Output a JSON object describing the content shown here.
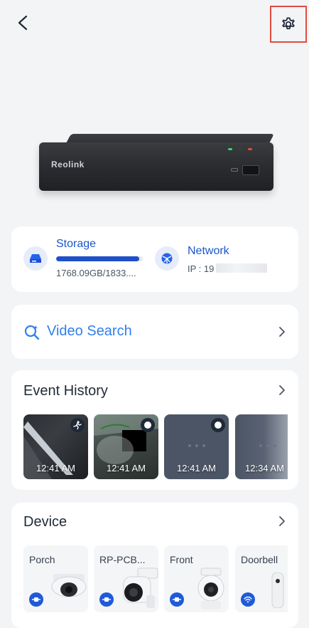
{
  "header": {
    "back_icon": "chevron-left-icon",
    "settings_icon": "gear-icon",
    "highlight_color": "#e04b3f"
  },
  "device_image": {
    "brand": "Reolink"
  },
  "storage": {
    "title": "Storage",
    "usage": "1768.09GB/1833....",
    "used_fraction": 0.96,
    "icon": "hard-drive-icon"
  },
  "network": {
    "title": "Network",
    "ip": "IP : 19",
    "icon": "network-globe-icon"
  },
  "video_search": {
    "label": "Video Search",
    "icon": "search-sparkle-icon"
  },
  "event_history": {
    "title": "Event History",
    "items": [
      {
        "time": "12:41 AM",
        "badge": "person-icon"
      },
      {
        "time": "12:41 AM",
        "badge": "circle-icon"
      },
      {
        "time": "12:41 AM",
        "badge": "circle-icon"
      },
      {
        "time": "12:34 AM",
        "badge": "circle-icon"
      }
    ]
  },
  "device": {
    "title": "Device",
    "items": [
      {
        "name": "Porch",
        "badge": "plug-icon"
      },
      {
        "name": "RP-PCB...",
        "badge": "plug-icon"
      },
      {
        "name": "Front",
        "badge": "plug-icon"
      },
      {
        "name": "Doorbell",
        "badge": "wifi-icon"
      }
    ]
  },
  "colors": {
    "accent": "#1a56c9",
    "link": "#2f80ed",
    "background": "#f3f4f6"
  }
}
